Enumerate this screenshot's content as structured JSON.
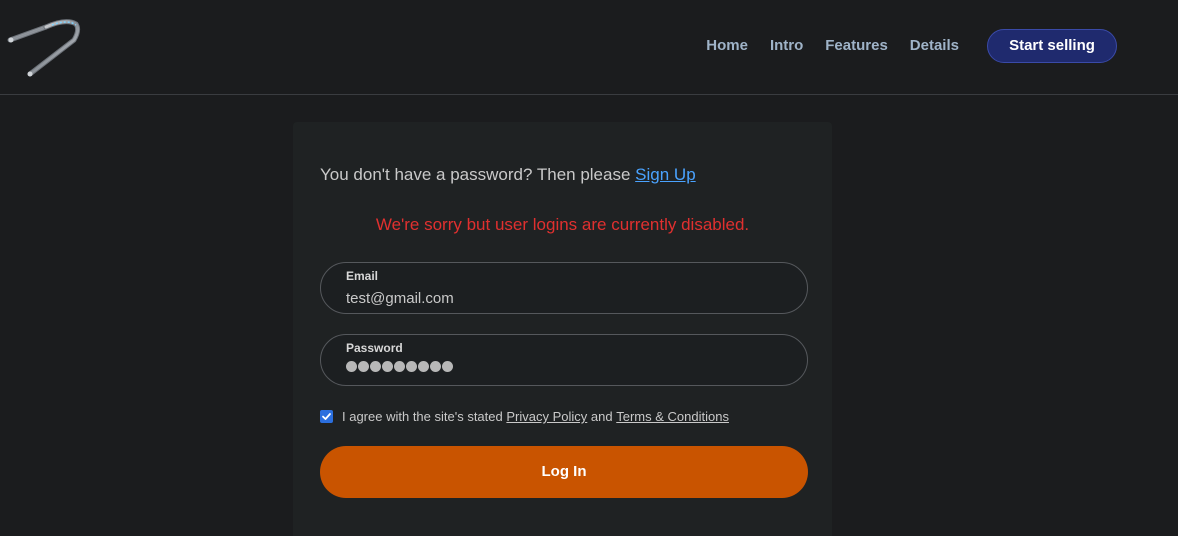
{
  "header": {
    "logo_icon": "bent-metal-rod-logo",
    "nav": [
      "Home",
      "Intro",
      "Features",
      "Details"
    ],
    "cta_label": "Start selling"
  },
  "login": {
    "signup_prompt": "You don't have a password? Then please",
    "signup_link": "Sign Up",
    "error_message": "We're sorry but user logins are currently disabled.",
    "email_label": "Email",
    "email_value": "test@gmail.com",
    "password_label": "Password",
    "password_masked_count": 9,
    "agree_checked": true,
    "agree_prefix": "I agree with the site's stated",
    "privacy_link": "Privacy Policy",
    "agree_and": "and",
    "terms_link": "Terms & Conditions",
    "login_button": "Log In"
  },
  "colors": {
    "background": "#1b1c1e",
    "accent_orange": "#c95400",
    "error_red": "#e0302f",
    "link_blue": "#4aa3ff",
    "cta_navy": "#1f2a6e"
  }
}
